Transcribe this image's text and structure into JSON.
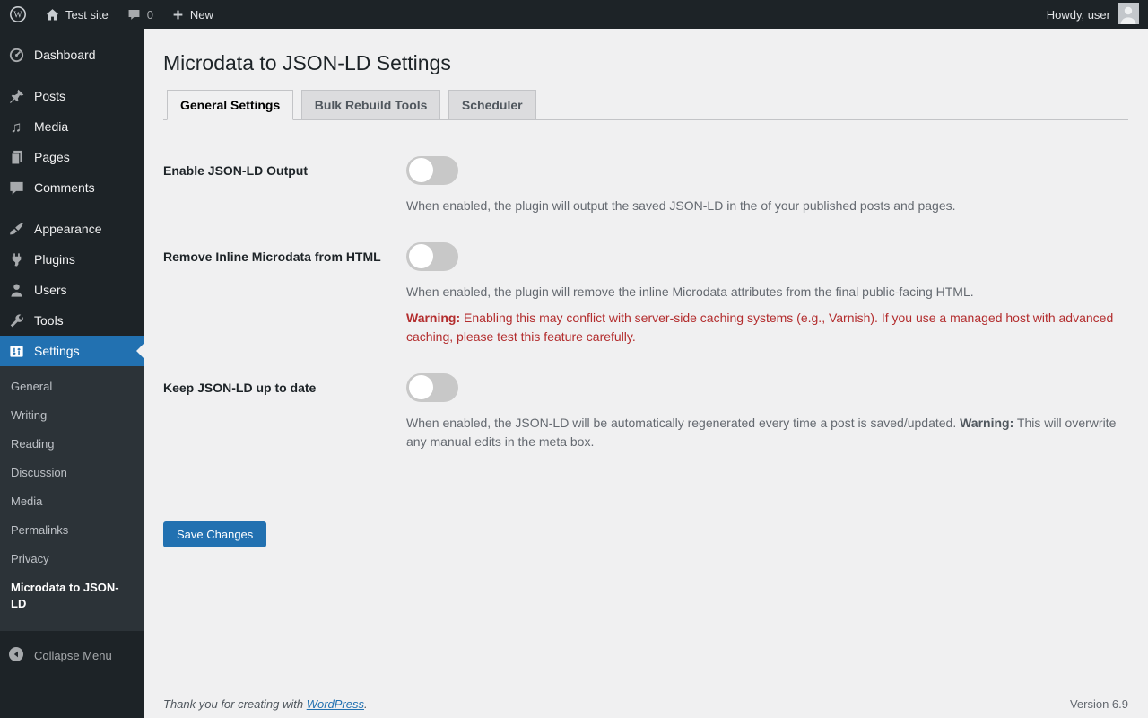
{
  "admin_bar": {
    "site_name": "Test site",
    "comment_count": "0",
    "new_label": "New",
    "howdy": "Howdy, user"
  },
  "sidebar": {
    "items": [
      {
        "label": "Dashboard"
      },
      {
        "label": "Posts"
      },
      {
        "label": "Media"
      },
      {
        "label": "Pages"
      },
      {
        "label": "Comments"
      },
      {
        "label": "Appearance"
      },
      {
        "label": "Plugins"
      },
      {
        "label": "Users"
      },
      {
        "label": "Tools"
      },
      {
        "label": "Settings",
        "active": true
      }
    ],
    "settings_submenu": [
      "General",
      "Writing",
      "Reading",
      "Discussion",
      "Media",
      "Permalinks",
      "Privacy",
      "Microdata to JSON-LD"
    ],
    "active_submenu_item": "Microdata to JSON-LD",
    "collapse_label": "Collapse Menu"
  },
  "page": {
    "title": "Microdata to JSON-LD Settings",
    "tabs": [
      {
        "label": "General Settings",
        "active": true
      },
      {
        "label": "Bulk Rebuild Tools",
        "active": false
      },
      {
        "label": "Scheduler",
        "active": false
      }
    ],
    "settings": [
      {
        "label": "Enable JSON-LD Output",
        "toggle_state": "off",
        "description": "When enabled, the plugin will output the saved JSON-LD in the of your published posts and pages."
      },
      {
        "label": "Remove Inline Microdata from HTML",
        "toggle_state": "off",
        "description": "When enabled, the plugin will remove the inline Microdata attributes from the final public-facing HTML.",
        "warning_label": "Warning:",
        "warning_text": " Enabling this may conflict with server-side caching systems (e.g., Varnish). If you use a managed host with advanced caching, please test this feature carefully."
      },
      {
        "label": "Keep JSON-LD up to date",
        "toggle_state": "off",
        "description": "When enabled, the JSON-LD will be automatically regenerated every time a post is saved/updated. ",
        "inline_warning_label": "Warning:",
        "inline_warning_text": " This will overwrite any manual edits in the meta box."
      }
    ],
    "save_button": "Save Changes"
  },
  "footer": {
    "thanks_prefix": "Thank you for creating with ",
    "wordpress_link": "WordPress",
    "thanks_suffix": ".",
    "version": "Version 6.9"
  },
  "colors": {
    "accent_blue": "#2271b1",
    "warning_red": "#b32d2e",
    "sidebar_bg": "#1d2327",
    "submenu_bg": "#2c3338",
    "content_bg": "#f0f0f1"
  }
}
